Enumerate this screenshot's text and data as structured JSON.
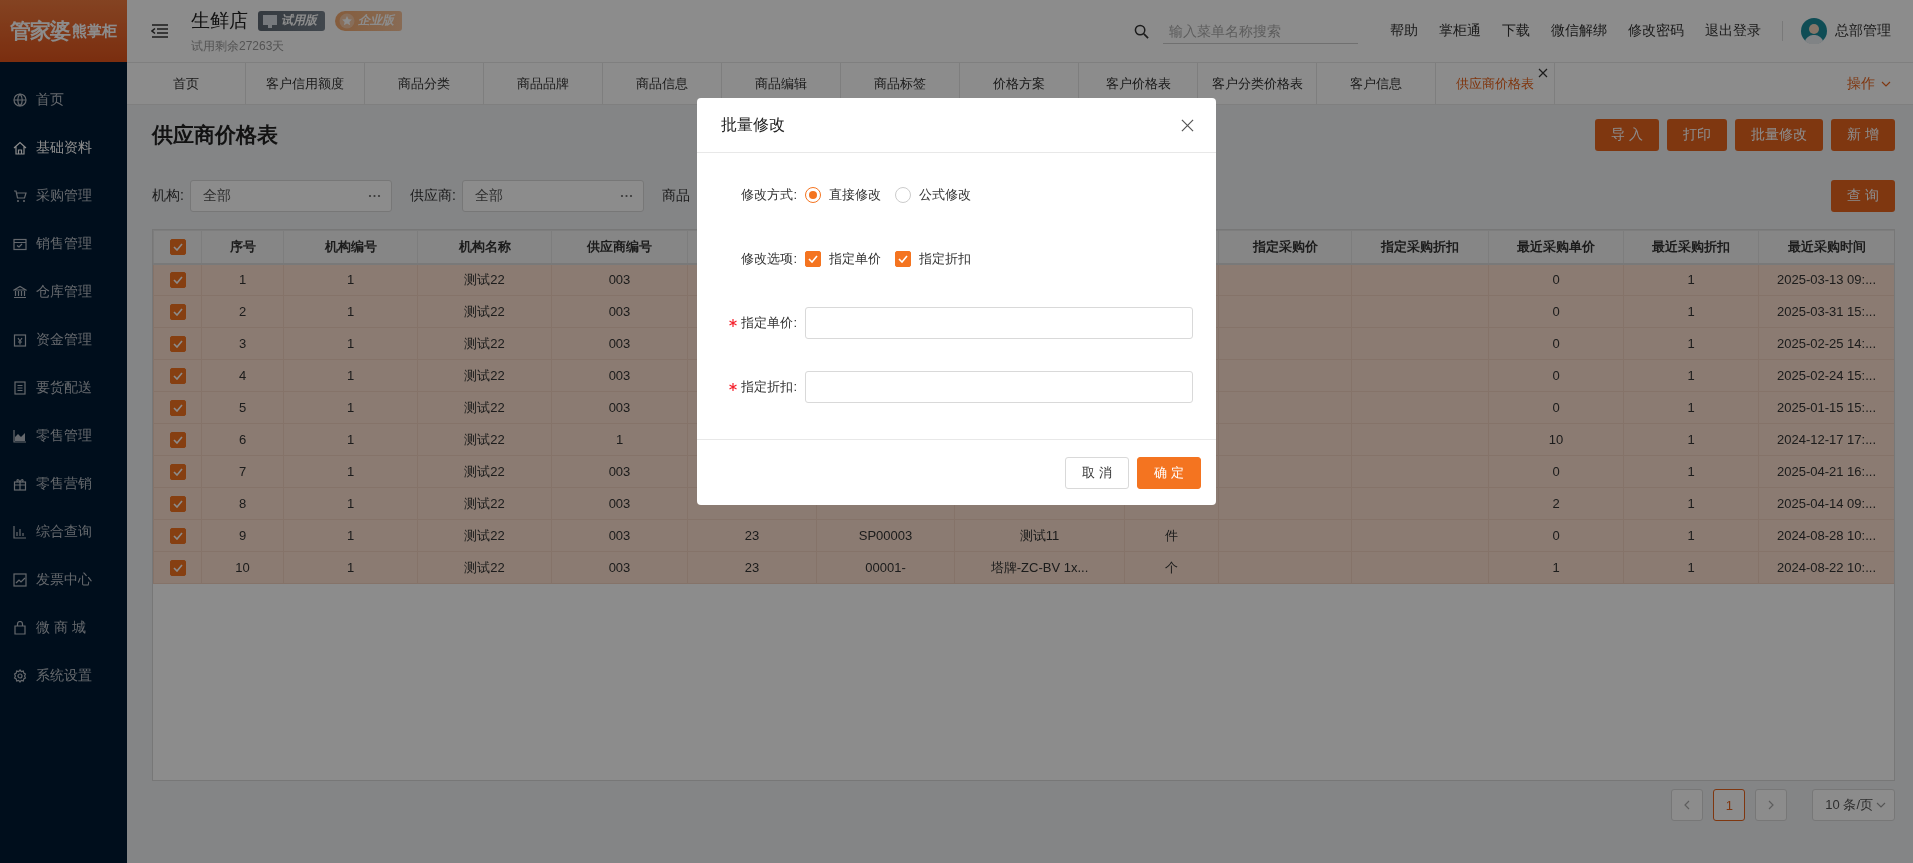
{
  "logo": {
    "brand": "管家婆",
    "product": "熊掌柜"
  },
  "header": {
    "store": "生鲜店",
    "badges": [
      {
        "label": "试用版",
        "kind": "trial"
      },
      {
        "label": "企业版",
        "kind": "enterprise"
      }
    ],
    "subtitle": "试用剩余27263天",
    "search": {
      "placeholder": "输入菜单名称搜索"
    },
    "links": [
      "帮助",
      "掌柜通",
      "下载",
      "微信解绑",
      "修改密码",
      "退出登录"
    ],
    "user": "总部管理"
  },
  "sidebar": {
    "items": [
      {
        "label": "首页",
        "kind": "globe",
        "selected": false
      },
      {
        "label": "基础资料",
        "kind": "home",
        "selected": true
      },
      {
        "label": "采购管理",
        "kind": "cart",
        "selected": false
      },
      {
        "label": "销售管理",
        "kind": "calendar",
        "selected": false
      },
      {
        "label": "仓库管理",
        "kind": "bank",
        "selected": false
      },
      {
        "label": "资金管理",
        "kind": "wallet",
        "selected": false
      },
      {
        "label": "要货配送",
        "kind": "list",
        "selected": false
      },
      {
        "label": "零售管理",
        "kind": "area",
        "selected": false
      },
      {
        "label": "零售营销",
        "kind": "gift",
        "selected": false
      },
      {
        "label": "综合查询",
        "kind": "bars",
        "selected": false
      },
      {
        "label": "发票中心",
        "kind": "trend",
        "selected": false
      },
      {
        "label": "微 商 城",
        "kind": "bag",
        "selected": false
      },
      {
        "label": "系统设置",
        "kind": "gear",
        "selected": false
      }
    ]
  },
  "tabs": [
    {
      "label": "首页",
      "selected": false,
      "closable": false
    },
    {
      "label": "客户信用额度",
      "selected": false,
      "closable": false
    },
    {
      "label": "商品分类",
      "selected": false,
      "closable": false
    },
    {
      "label": "商品品牌",
      "selected": false,
      "closable": false
    },
    {
      "label": "商品信息",
      "selected": false,
      "closable": false
    },
    {
      "label": "商品编辑",
      "selected": false,
      "closable": false
    },
    {
      "label": "商品标签",
      "selected": false,
      "closable": false
    },
    {
      "label": "价格方案",
      "selected": false,
      "closable": false
    },
    {
      "label": "客户价格表",
      "selected": false,
      "closable": false
    },
    {
      "label": "客户分类价格表",
      "selected": false,
      "closable": false
    },
    {
      "label": "客户信息",
      "selected": false,
      "closable": false
    },
    {
      "label": "供应商价格表",
      "selected": true,
      "closable": true
    }
  ],
  "tabs_menu": "操作",
  "page": {
    "title": "供应商价格表",
    "actions": [
      "导 入",
      "打印",
      "批量修改",
      "新 增"
    ],
    "filters": [
      {
        "label": "机构:",
        "value": "全部"
      },
      {
        "label": "供应商:",
        "value": "全部"
      },
      {
        "label": "商品"
      }
    ],
    "query_button": "查 询"
  },
  "table": {
    "all_selected": true,
    "columns": [
      "序号",
      "机构编号",
      "机构名称",
      "供应商编号",
      null,
      null,
      null,
      null,
      "指定采购价",
      "指定采购折扣",
      "最近采购单价",
      "最近采购折扣",
      "最近采购时间"
    ],
    "rows": [
      {
        "selected": true,
        "cells": [
          "1",
          "1",
          "测试22",
          "003",
          null,
          null,
          null,
          null,
          null,
          null,
          "0",
          "1",
          "2025-03-13 09:..."
        ]
      },
      {
        "selected": true,
        "cells": [
          "2",
          "1",
          "测试22",
          "003",
          null,
          null,
          null,
          null,
          null,
          null,
          "0",
          "1",
          "2025-03-31 15:..."
        ]
      },
      {
        "selected": true,
        "cells": [
          "3",
          "1",
          "测试22",
          "003",
          null,
          null,
          null,
          null,
          null,
          null,
          "0",
          "1",
          "2025-02-25 14:..."
        ]
      },
      {
        "selected": true,
        "cells": [
          "4",
          "1",
          "测试22",
          "003",
          null,
          null,
          null,
          null,
          null,
          null,
          "0",
          "1",
          "2025-02-24 15:..."
        ]
      },
      {
        "selected": true,
        "cells": [
          "5",
          "1",
          "测试22",
          "003",
          null,
          null,
          null,
          null,
          null,
          null,
          "0",
          "1",
          "2025-01-15 15:..."
        ]
      },
      {
        "selected": true,
        "cells": [
          "6",
          "1",
          "测试22",
          "1",
          null,
          null,
          null,
          null,
          null,
          null,
          "10",
          "1",
          "2024-12-17 17:..."
        ]
      },
      {
        "selected": true,
        "cells": [
          "7",
          "1",
          "测试22",
          "003",
          null,
          null,
          null,
          null,
          null,
          null,
          "0",
          "1",
          "2025-04-21 16:..."
        ]
      },
      {
        "selected": true,
        "cells": [
          "8",
          "1",
          "测试22",
          "003",
          null,
          null,
          null,
          null,
          null,
          null,
          "2",
          "1",
          "2025-04-14 09:..."
        ]
      },
      {
        "selected": true,
        "cells": [
          "9",
          "1",
          "测试22",
          "003",
          "23",
          "SP00003",
          "测试11",
          "件",
          null,
          null,
          "0",
          "1",
          "2024-08-28 10:..."
        ]
      },
      {
        "selected": true,
        "cells": [
          "10",
          "1",
          "测试22",
          "003",
          "23",
          "00001-",
          "塔牌-ZC-BV 1x...",
          "个",
          null,
          null,
          "1",
          "1",
          "2024-08-22 10:..."
        ]
      }
    ]
  },
  "pagination": {
    "pages": [
      {
        "label": "1",
        "selected": true
      }
    ],
    "page_size": "10 条/页"
  },
  "dialog": {
    "title": "批量修改",
    "mode": {
      "label": "修改方式:",
      "options": [
        {
          "label": "直接修改",
          "selected": true
        },
        {
          "label": "公式修改",
          "selected": false
        }
      ]
    },
    "options": {
      "label": "修改选项:",
      "items": [
        {
          "label": "指定单价",
          "checked": true
        },
        {
          "label": "指定折扣",
          "checked": true
        }
      ]
    },
    "fields": [
      {
        "label": "指定单价:",
        "required": true
      },
      {
        "label": "指定折扣:",
        "required": true
      }
    ],
    "buttons": [
      {
        "label": "取 消",
        "kind": "secondary"
      },
      {
        "label": "确 定",
        "kind": "primary"
      }
    ]
  }
}
